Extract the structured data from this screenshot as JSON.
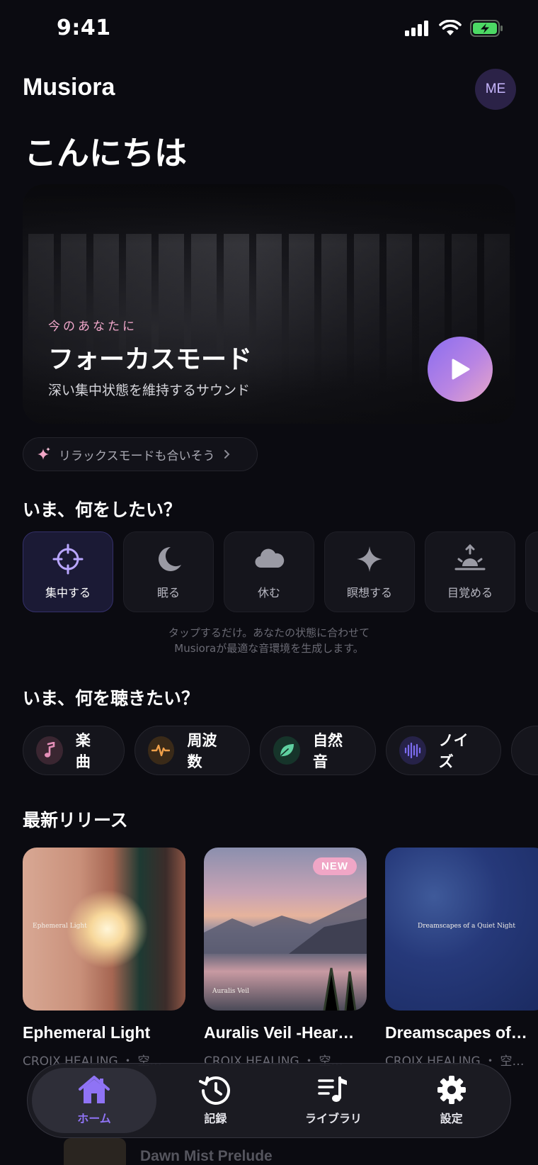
{
  "status": {
    "time": "9:41"
  },
  "header": {
    "app_name": "Musiora",
    "avatar_initials": "ME",
    "greeting": "こんにちは"
  },
  "hero": {
    "eyebrow": "今のあなたに",
    "title": "フォーカスモード",
    "subtitle": "深い集中状態を維持するサウンド"
  },
  "suggestion": {
    "text": "リラックスモードも合いそう"
  },
  "moods": {
    "title": "いま、何をしたい？",
    "items": [
      {
        "label": "集中する",
        "icon": "crosshair-icon",
        "active": true
      },
      {
        "label": "眠る",
        "icon": "moon-icon"
      },
      {
        "label": "休む",
        "icon": "cloud-icon"
      },
      {
        "label": "瞑想する",
        "icon": "sparkle-icon"
      },
      {
        "label": "目覚める",
        "icon": "sunrise-icon"
      }
    ],
    "hint_line1": "タップするだけ。あなたの状態に合わせて",
    "hint_line2": "Musioraが最適な音環境を生成します。"
  },
  "categories": {
    "title": "いま、何を聴きたい？",
    "items": [
      {
        "label": "楽曲",
        "icon": "music-note-icon",
        "color": "#e58fb8"
      },
      {
        "label": "周波数",
        "icon": "waveform-icon",
        "color": "#f0a04a"
      },
      {
        "label": "自然音",
        "icon": "leaf-icon",
        "color": "#5fd0a0"
      },
      {
        "label": "ノイズ",
        "icon": "sound-bars-icon",
        "color": "#7c6cf0"
      }
    ]
  },
  "releases": {
    "title": "最新リリース",
    "items": [
      {
        "title": "Ephemeral Light",
        "artist": "CROIX HEALING ・ 空…",
        "cover_text": "Ephemeral Light"
      },
      {
        "title": "Auralis Veil -Hear…",
        "artist": "CROIX HEALING ・ 空…",
        "badge": "NEW",
        "cover_text": "Auralis Veil"
      },
      {
        "title": "Dreamscapes of…",
        "artist": "CROIX HEALING ・ 空…",
        "cover_text": "Dreamscapes of a Quiet Night"
      }
    ]
  },
  "peek": {
    "title": "Dawn Mist Prelude"
  },
  "tabbar": {
    "items": [
      {
        "label": "ホーム",
        "icon": "home-icon",
        "active": true
      },
      {
        "label": "記録",
        "icon": "history-icon"
      },
      {
        "label": "ライブラリ",
        "icon": "music-list-icon"
      },
      {
        "label": "設定",
        "icon": "gear-icon"
      }
    ]
  },
  "colors": {
    "background": "#0b0b11",
    "accent": "#8f73f5",
    "pink": "#f0a6c6"
  }
}
